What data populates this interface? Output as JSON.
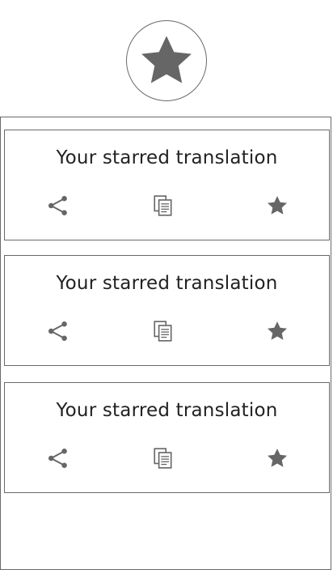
{
  "header": {
    "icon": "star-icon"
  },
  "cards": [
    {
      "text": "Your starred translation",
      "actions": {
        "share": "share-icon",
        "copy": "copy-icon",
        "star": "star-icon"
      }
    },
    {
      "text": "Your starred translation",
      "actions": {
        "share": "share-icon",
        "copy": "copy-icon",
        "star": "star-icon"
      }
    },
    {
      "text": "Your starred translation",
      "actions": {
        "share": "share-icon",
        "copy": "copy-icon",
        "star": "star-icon"
      }
    }
  ],
  "colors": {
    "icon": "#666666",
    "border": "#6a6a6a",
    "text": "#222222",
    "background": "#ffffff"
  }
}
